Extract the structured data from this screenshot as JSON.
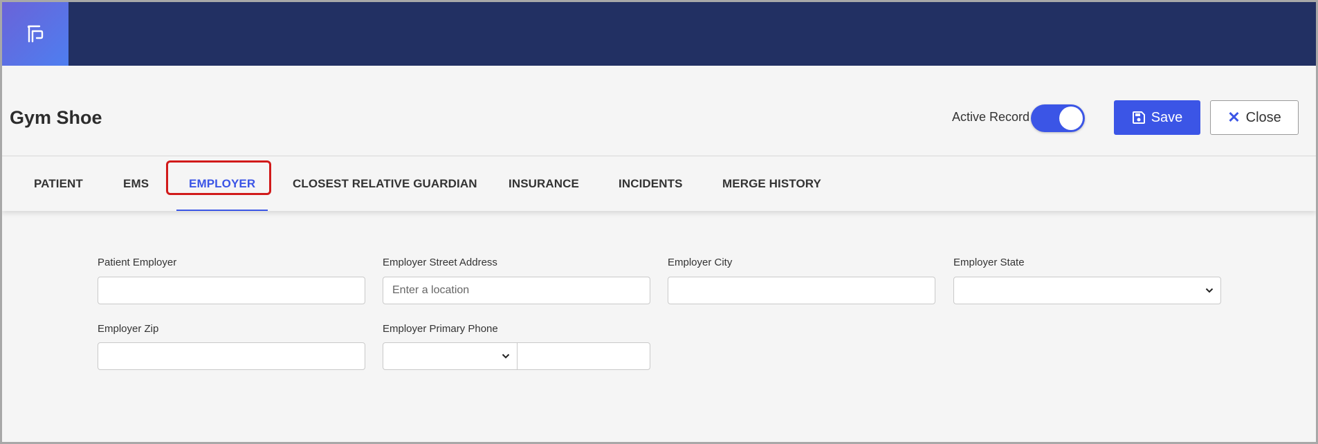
{
  "app": {
    "logo_icon": "document-logo-icon"
  },
  "header": {
    "title": "Gym Shoe",
    "active_record_label": "Active Record",
    "active_record_on": true,
    "save_label": "Save",
    "close_label": "Close"
  },
  "tabs": [
    {
      "label": "PATIENT"
    },
    {
      "label": "EMS"
    },
    {
      "label": "EMPLOYER"
    },
    {
      "label": "CLOSEST RELATIVE GUARDIAN"
    },
    {
      "label": "INSURANCE"
    },
    {
      "label": "INCIDENTS"
    },
    {
      "label": "MERGE HISTORY"
    }
  ],
  "active_tab": "EMPLOYER",
  "form": {
    "patient_employer": {
      "label": "Patient Employer",
      "value": ""
    },
    "street_address": {
      "label": "Employer Street Address",
      "value": "",
      "placeholder": "Enter a location"
    },
    "city": {
      "label": "Employer City",
      "value": ""
    },
    "state": {
      "label": "Employer State",
      "selected": ""
    },
    "zip": {
      "label": "Employer Zip",
      "value": ""
    },
    "phone": {
      "label": "Employer Primary Phone",
      "type_selected": "",
      "value": ""
    }
  },
  "colors": {
    "accent": "#3b55e6",
    "topbar": "#223063",
    "highlight": "#d11a1a"
  }
}
